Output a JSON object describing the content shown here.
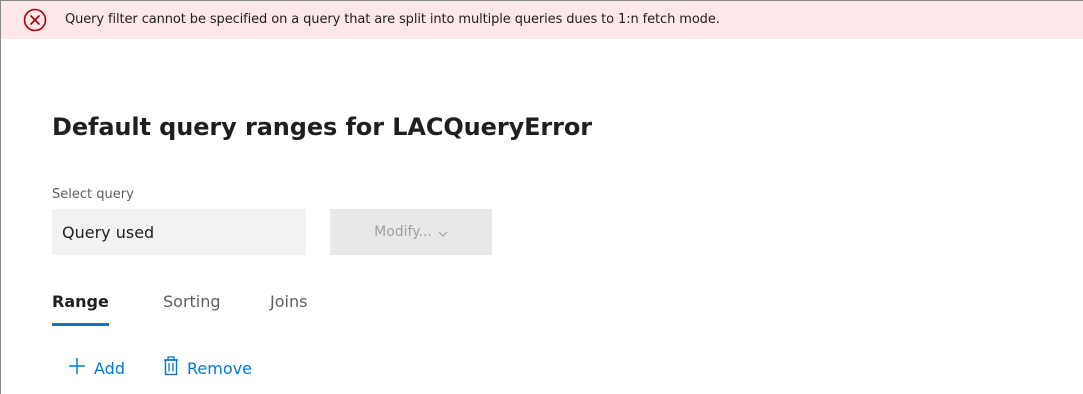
{
  "error": {
    "message": "Query filter cannot be specified on a query that are split into multiple queries dues to 1:n fetch mode.",
    "icon": "error-circle-icon",
    "color": "#a80000"
  },
  "page": {
    "title": "Default query ranges for LACQueryError"
  },
  "query_select": {
    "label": "Select query",
    "value": "Query used"
  },
  "modify_button": {
    "label": "Modify..."
  },
  "tabs": [
    {
      "label": "Range",
      "selected": true
    },
    {
      "label": "Sorting",
      "selected": false
    },
    {
      "label": "Joins",
      "selected": false
    }
  ],
  "toolbar": {
    "add_label": "Add",
    "remove_label": "Remove"
  },
  "colors": {
    "accent": "#0078d4",
    "error_background": "#fde7e9"
  }
}
